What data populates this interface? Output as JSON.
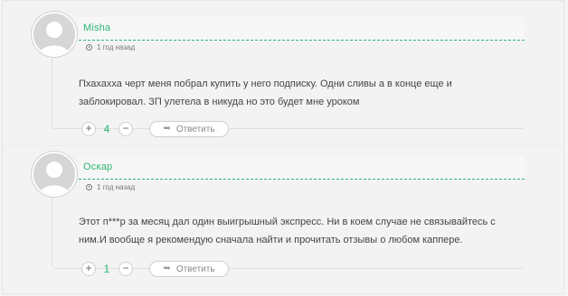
{
  "comments": [
    {
      "author": "Misha",
      "time": "1 год назад",
      "text": "Пхахахха черт меня побрал купить у него подписку. Одни сливы а в конце еще и заблокировал. ЗП улетела в никуда но это будет мне уроком",
      "score": "4",
      "reply_label": "Ответить",
      "plus": "+",
      "minus": "−"
    },
    {
      "author": "Оскар",
      "time": "1 год назад",
      "text": "Этот п***р за месяц дал один выигрышный экспресс. Ни в коем случае не связывайтесь с ним.И вообще я рекомендую сначала найти и прочитать отзывы о любом каппере.",
      "score": "1",
      "reply_label": "Ответить",
      "plus": "+",
      "minus": "−"
    }
  ],
  "colors": {
    "accent": "#2bb673",
    "background": "#f3f3f3",
    "text": "#444444"
  },
  "icons": {
    "avatar": "default-user-avatar",
    "time": "clock-icon",
    "reply": "reply-arrow-icon"
  }
}
